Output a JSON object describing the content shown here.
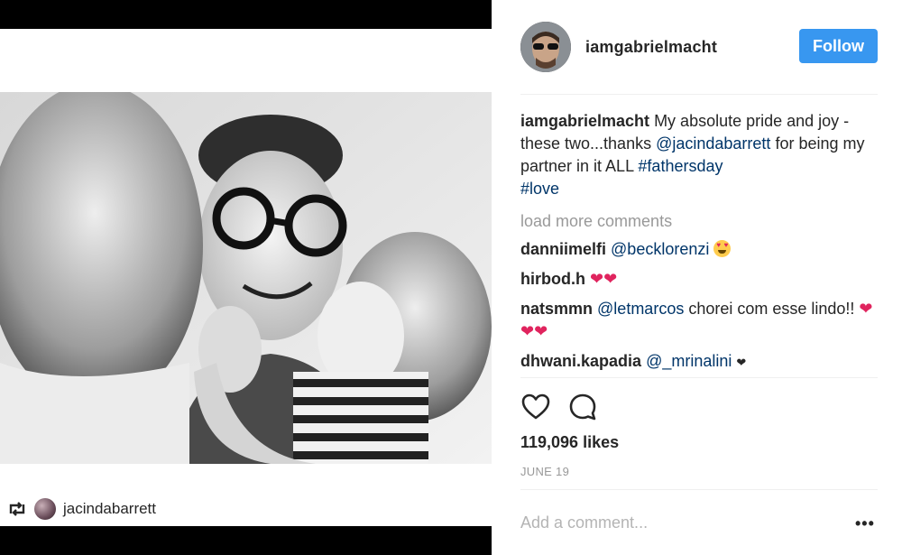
{
  "post": {
    "author": "iamgabrielmacht",
    "follow_label": "Follow",
    "caption": {
      "author": "iamgabrielmacht",
      "text_1": " My absolute pride and joy - these two...thanks ",
      "mention": "@jacindabarrett",
      "text_2": " for being my partner in it ALL ",
      "hashtag_1": "#fathersday",
      "hashtag_2": "#love"
    },
    "load_more": "load more comments",
    "comments": [
      {
        "user": "danniimelfi",
        "mention": "@becklorenzi",
        "emoji": "heart-eyes-emoji"
      },
      {
        "user": "hirbod.h",
        "hearts": "❤❤"
      },
      {
        "user": "natsmmn",
        "mention": "@letmarcos",
        "text": " chorei com esse lindo!! ",
        "hearts": "❤❤❤"
      },
      {
        "user": "dhwani.kapadia",
        "mention": "@_mrinalini",
        "small_heart": "❤"
      }
    ],
    "likes": "119,096 likes",
    "date": "JUNE 19",
    "add_comment_placeholder": "Add a comment...",
    "more_options": "•••"
  },
  "repost": {
    "user": "jacindabarrett",
    "icon": "repost-icon"
  },
  "icons": {
    "like": "heart-outline-icon",
    "comment": "comment-bubble-icon"
  },
  "colors": {
    "follow_button": "#3897f0",
    "link": "#003569",
    "muted": "#999999",
    "heart": "#e0245e"
  }
}
